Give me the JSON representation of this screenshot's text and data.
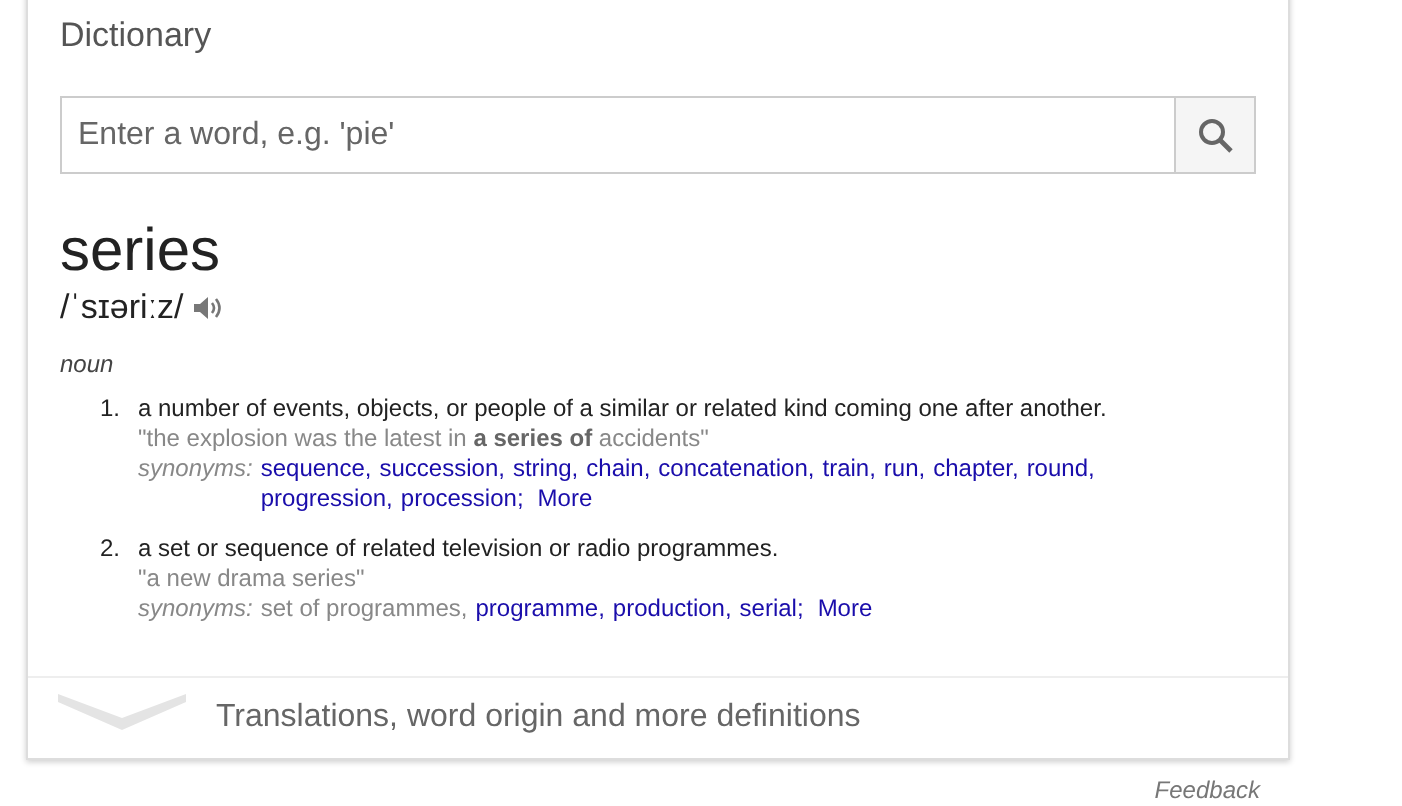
{
  "title": "Dictionary",
  "search": {
    "placeholder": "Enter a word, e.g. 'pie'"
  },
  "word": "series",
  "pronunciation": "/ˈsɪəriːz/",
  "part_of_speech": "noun",
  "definitions": [
    {
      "number": "1.",
      "text": "a number of events, objects, or people of a similar or related kind coming one after another.",
      "example": "\"the explosion was the latest in **a series of** accidents\"",
      "synonyms_label": "synonyms:",
      "synonyms": [
        {
          "text": "sequence,",
          "kind": "link"
        },
        {
          "text": "succession,",
          "kind": "link"
        },
        {
          "text": "string,",
          "kind": "link"
        },
        {
          "text": "chain,",
          "kind": "link"
        },
        {
          "text": "concatenation,",
          "kind": "link"
        },
        {
          "text": "train,",
          "kind": "link"
        },
        {
          "text": "run,",
          "kind": "link"
        },
        {
          "text": "chapter,",
          "kind": "link"
        },
        {
          "text": "round,",
          "kind": "link"
        },
        {
          "text": "progression,",
          "kind": "link"
        },
        {
          "text": "procession;",
          "kind": "link"
        }
      ],
      "more": "More"
    },
    {
      "number": "2.",
      "text": "a set or sequence of related television or radio programmes.",
      "example": "\"a new drama series\"",
      "synonyms_label": "synonyms:",
      "synonyms": [
        {
          "text": "set of programmes,",
          "kind": "plain"
        },
        {
          "text": "programme,",
          "kind": "link"
        },
        {
          "text": "production,",
          "kind": "link"
        },
        {
          "text": "serial;",
          "kind": "link"
        }
      ],
      "more": "More"
    }
  ],
  "expander": "Translations, word origin and more definitions",
  "feedback": "Feedback"
}
